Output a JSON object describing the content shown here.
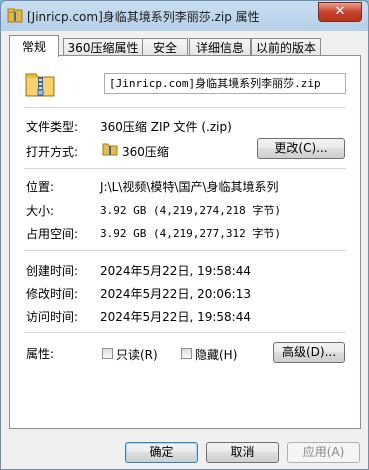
{
  "window": {
    "title": "[Jinricp.com]身临其境系列李丽莎.zip 属性",
    "close_glyph": "✕"
  },
  "tabs": [
    {
      "label": "常规"
    },
    {
      "label": "360压缩属性"
    },
    {
      "label": "安全"
    },
    {
      "label": "详细信息"
    },
    {
      "label": "以前的版本"
    }
  ],
  "general": {
    "filename": "[Jinricp.com]身临其境系列李丽莎.zip",
    "file_type_label": "文件类型:",
    "file_type_value": "360压缩 ZIP 文件 (.zip)",
    "opens_with_label": "打开方式:",
    "opens_with_value": "360压缩",
    "change_button": "更改(C)...",
    "location_label": "位置:",
    "location_value": "J:\\L\\视频\\模特\\国产\\身临其境系列",
    "size_label": "大小:",
    "size_value": "3.92 GB (4,219,274,218 字节)",
    "size_on_disk_label": "占用空间:",
    "size_on_disk_value": "3.92 GB (4,219,277,312 字节)",
    "created_label": "创建时间:",
    "created_value": "2024年5月22日, 19:58:44",
    "modified_label": "修改时间:",
    "modified_value": "2024年5月22日, 20:06:13",
    "accessed_label": "访问时间:",
    "accessed_value": "2024年5月22日, 19:58:44",
    "attributes_label": "属性:",
    "readonly_label": "只读(R)",
    "hidden_label": "隐藏(H)",
    "advanced_button": "高级(D)..."
  },
  "footer": {
    "ok": "确定",
    "cancel": "取消",
    "apply": "应用(A)"
  },
  "icons": [
    "zip-file-icon",
    "zip-archive-small-icon"
  ]
}
